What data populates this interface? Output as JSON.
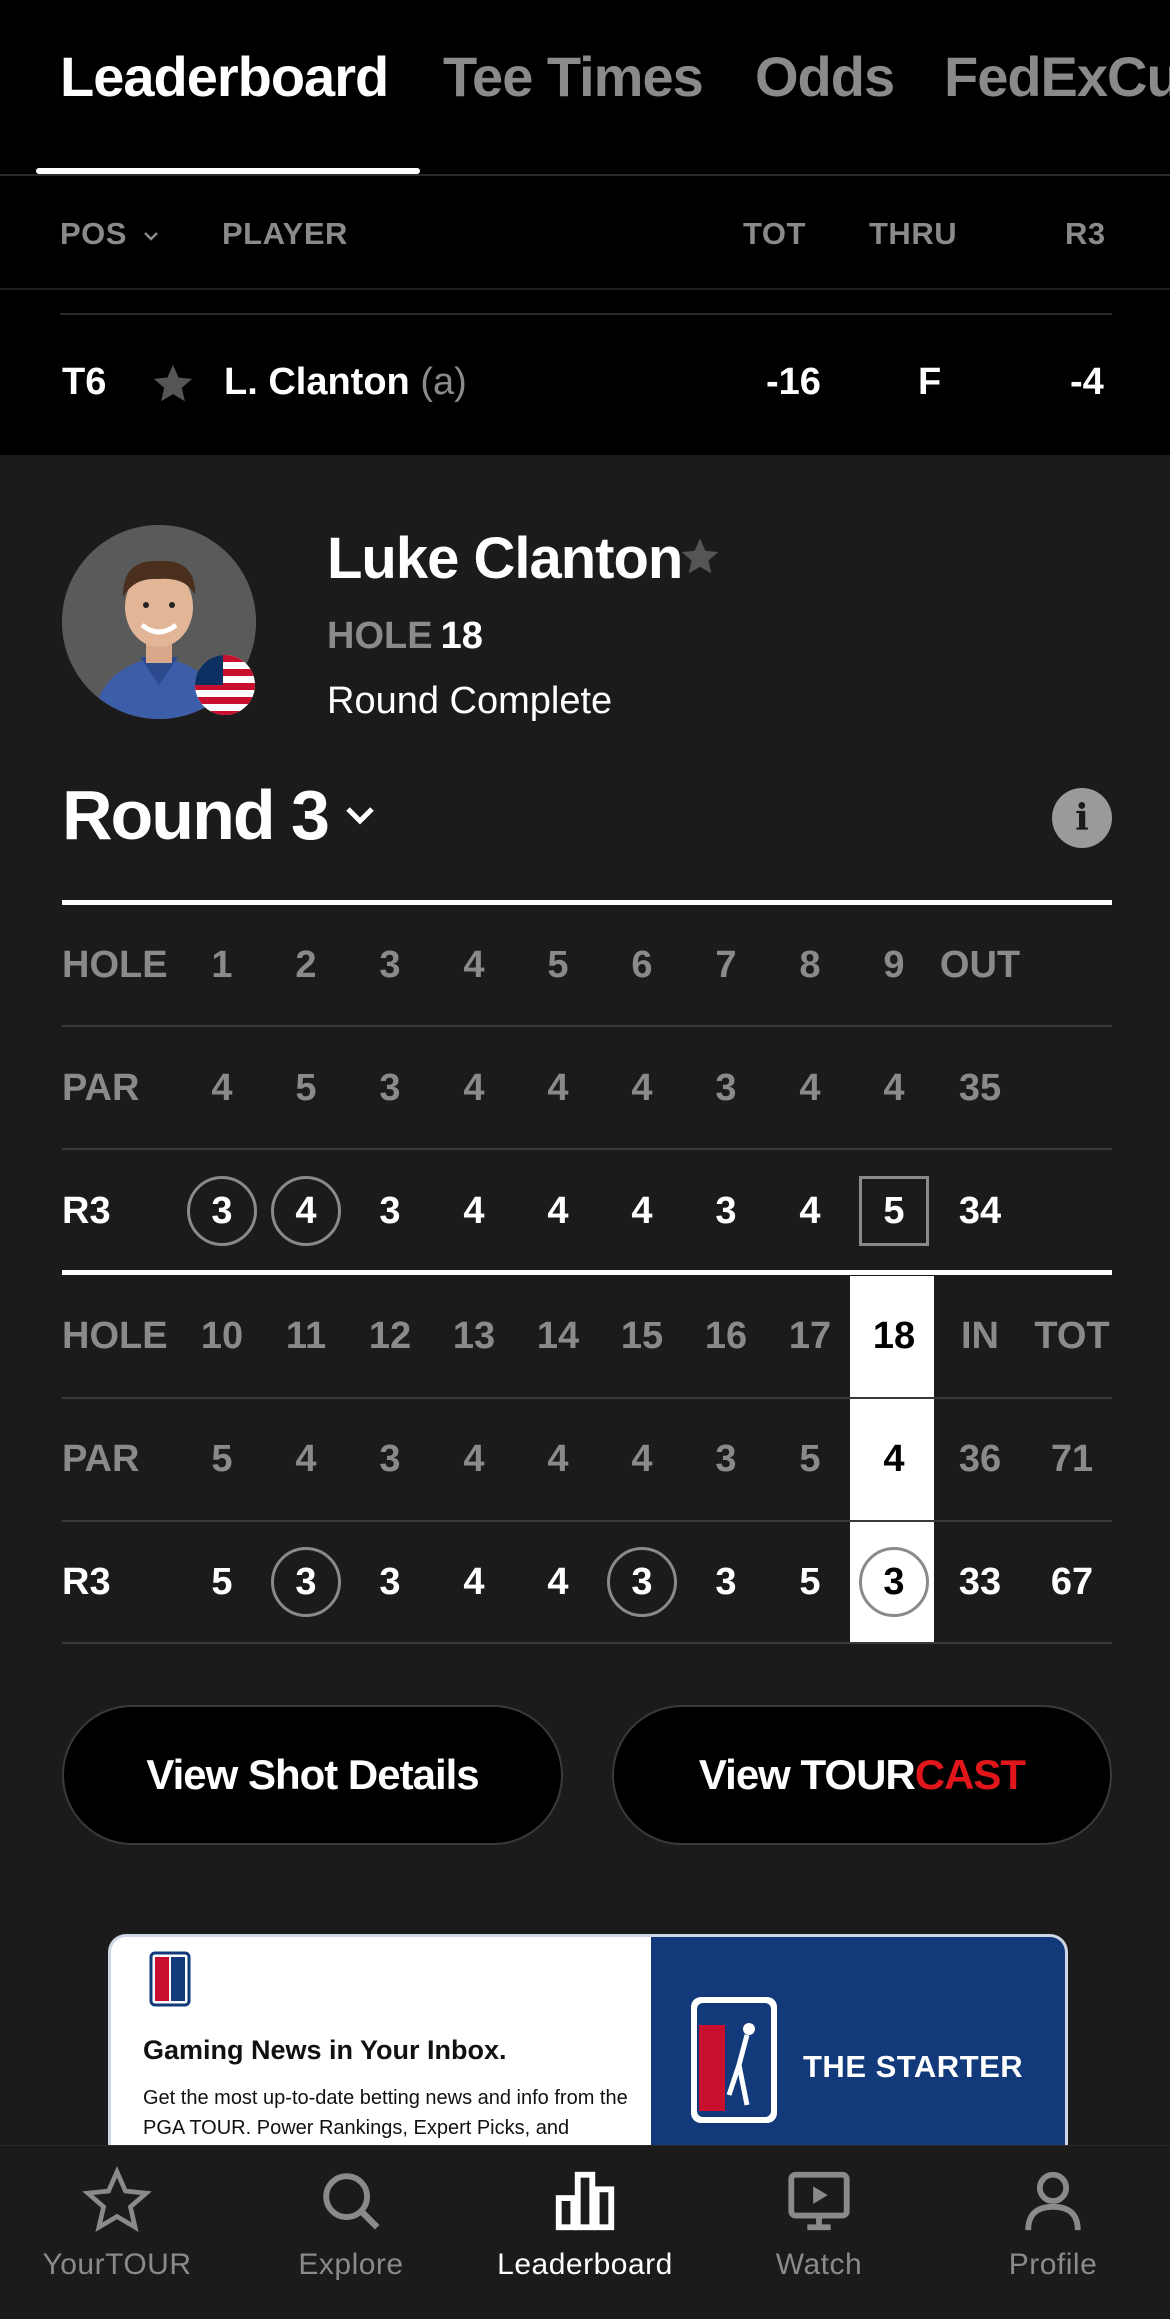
{
  "tabs": [
    "Leaderboard",
    "Tee Times",
    "Odds",
    "FedExCup"
  ],
  "columns": {
    "pos": "POS",
    "player": "PLAYER",
    "tot": "TOT",
    "thru": "THRU",
    "round": "R3"
  },
  "player_row": {
    "pos": "T6",
    "name": "L. Clanton",
    "amateur": "(a)",
    "tot": "-16",
    "thru": "F",
    "round": "-4"
  },
  "player": {
    "full_name": "Luke Clanton",
    "hole_label": "HOLE",
    "hole_value": "18",
    "status": "Round Complete",
    "round_label": "Round 3"
  },
  "scorecard": {
    "front": {
      "hole_label": "HOLE",
      "holes": [
        "1",
        "2",
        "3",
        "4",
        "5",
        "6",
        "7",
        "8",
        "9"
      ],
      "sum_label": "OUT",
      "par_label": "PAR",
      "par": [
        "4",
        "5",
        "3",
        "4",
        "4",
        "4",
        "3",
        "4",
        "4"
      ],
      "par_sum": "35",
      "score_label": "R3",
      "scores": [
        "3",
        "4",
        "3",
        "4",
        "4",
        "4",
        "3",
        "4",
        "5"
      ],
      "score_marks": [
        "circle",
        "circle",
        "",
        "",
        "",
        "",
        "",
        "",
        "square"
      ],
      "score_sum": "34"
    },
    "back": {
      "hole_label": "HOLE",
      "holes": [
        "10",
        "11",
        "12",
        "13",
        "14",
        "15",
        "16",
        "17",
        "18"
      ],
      "sum_label": "IN",
      "tot_label": "TOT",
      "par_label": "PAR",
      "par": [
        "5",
        "4",
        "3",
        "4",
        "4",
        "4",
        "3",
        "5",
        "4"
      ],
      "par_sum": "36",
      "par_tot": "71",
      "score_label": "R3",
      "scores": [
        "5",
        "3",
        "3",
        "4",
        "4",
        "3",
        "3",
        "5",
        "3"
      ],
      "score_marks": [
        "",
        "circle",
        "",
        "",
        "",
        "circle",
        "",
        "",
        "circle"
      ],
      "score_sum": "33",
      "score_tot": "67"
    }
  },
  "buttons": {
    "shot_details": "View Shot Details",
    "tourcast_prefix": "View TOUR",
    "tourcast_suffix": "CAST"
  },
  "ad": {
    "title": "Gaming News in Your Inbox.",
    "body": "Get the most up-to-date betting news and info from the PGA TOUR. Power Rankings, Expert Picks, and",
    "brand": "THE STARTER"
  },
  "bottom_nav": [
    "YourTOUR",
    "Explore",
    "Leaderboard",
    "Watch",
    "Profile"
  ]
}
